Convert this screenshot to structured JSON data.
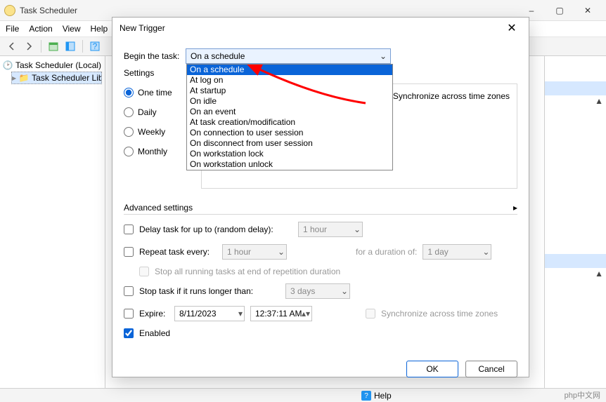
{
  "window": {
    "title": "Task Scheduler",
    "min_icon": "–",
    "max_icon": "▢",
    "close_icon": "✕"
  },
  "menu": {
    "file": "File",
    "action": "Action",
    "view": "View",
    "help": "Help"
  },
  "tree": {
    "root": "Task Scheduler (Local)",
    "lib": "Task Scheduler Library"
  },
  "help_label": "Help",
  "dialog": {
    "title": "New Trigger",
    "begin_label": "Begin the task:",
    "combo_value": "On a schedule",
    "options": [
      "On a schedule",
      "At log on",
      "At startup",
      "On idle",
      "On an event",
      "At task creation/modification",
      "On connection to user session",
      "On disconnect from user session",
      "On workstation lock",
      "On workstation unlock"
    ],
    "settings_label": "Settings",
    "freq": {
      "one": "One time",
      "daily": "Daily",
      "weekly": "Weekly",
      "monthly": "Monthly"
    },
    "sync_label": "Synchronize across time zones",
    "adv_label": "Advanced settings",
    "delay_label": "Delay task for up to (random delay):",
    "delay_value": "1 hour",
    "repeat_label": "Repeat task every:",
    "repeat_value": "1 hour",
    "duration_label": "for a duration of:",
    "duration_value": "1 day",
    "stop_all_label": "Stop all running tasks at end of repetition duration",
    "stop_longer_label": "Stop task if it runs longer than:",
    "stop_longer_value": "3 days",
    "expire_label": "Expire:",
    "expire_date": "8/11/2023",
    "expire_time": "12:37:11 AM",
    "expire_sync": "Synchronize across time zones",
    "enabled_label": "Enabled",
    "ok": "OK",
    "cancel": "Cancel"
  },
  "watermark": "php中文网"
}
